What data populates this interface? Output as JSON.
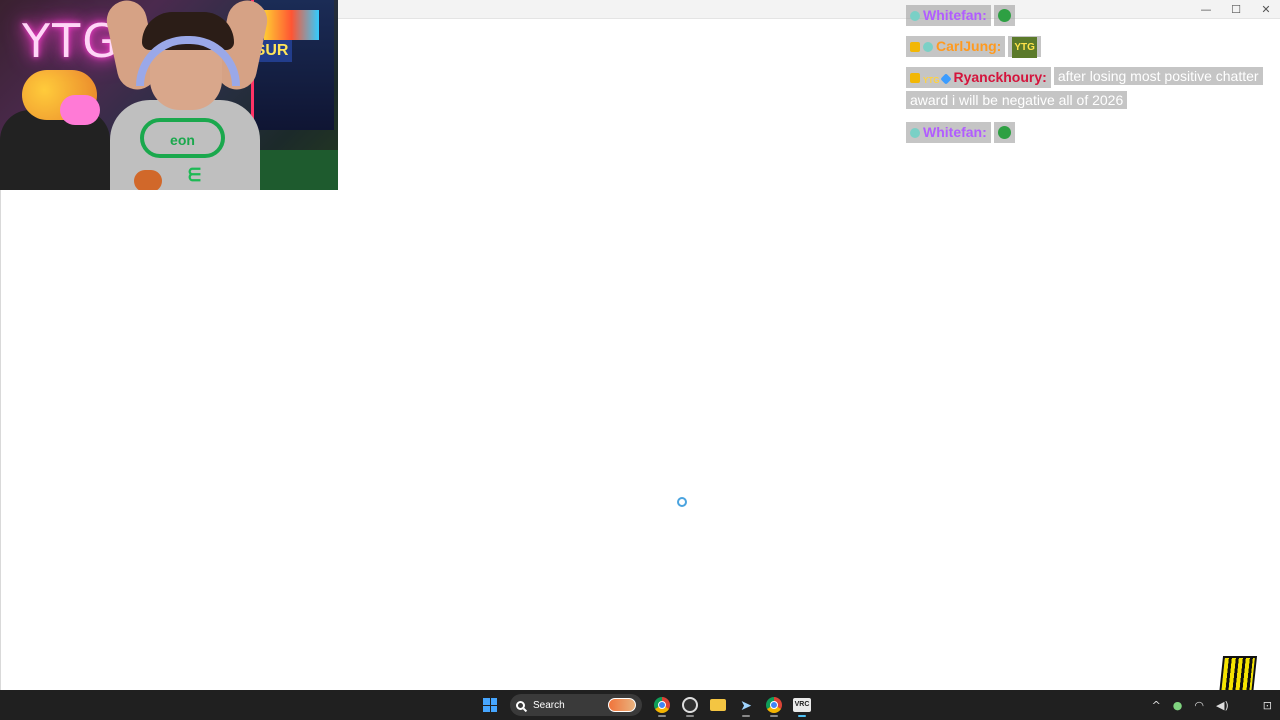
{
  "window": {
    "controls": {
      "minimize": "—",
      "maximize": "☐",
      "close": "✕"
    }
  },
  "webcam": {
    "neon_sign": "YTG",
    "shirt_text": "eon",
    "arcade_sign": "ESUR"
  },
  "chat": {
    "messages": [
      {
        "username": "Whitefan:",
        "name_color": "#b15cff",
        "badges": [
          "sub-icon"
        ],
        "text": "",
        "emotes": [
          "green-face-emote"
        ]
      },
      {
        "username": "CarlJung:",
        "name_color": "#ff9a1f",
        "badges": [
          "crown-icon",
          "sub-icon"
        ],
        "text": "",
        "emotes": [
          "ytg-emote"
        ]
      },
      {
        "username": "Ryanckhoury:",
        "name_color": "#d4143c",
        "badges": [
          "crown-icon",
          "ytg-badge-icon",
          "gem-icon"
        ],
        "text": "after losing most positive chatter award i will be negative all of 2026",
        "emotes": []
      },
      {
        "username": "Whitefan:",
        "name_color": "#b15cff",
        "badges": [
          "sub-icon"
        ],
        "text": "",
        "emotes": [
          "green-face-emote"
        ]
      }
    ],
    "ytg_emote_text": "YTG",
    "ytg_badge_text": "YTG"
  },
  "taskbar": {
    "search_label": "Search",
    "apps": [
      "start-icon",
      "search-box",
      "chrome-icon",
      "obs-icon",
      "file-explorer-icon",
      "steam-icon",
      "chrome-profile-icon",
      "vrchat-icon"
    ],
    "vrc_label": "VRC",
    "tray": {
      "chevron": "^",
      "mic": "🎙",
      "wifi": "📶",
      "volume": "🔊",
      "bell": "🔔"
    }
  },
  "colors": {
    "taskbar_bg": "#202020",
    "spinner": "#4aa3df",
    "chat_chip_bg": "rgba(150,150,150,0.55)"
  }
}
